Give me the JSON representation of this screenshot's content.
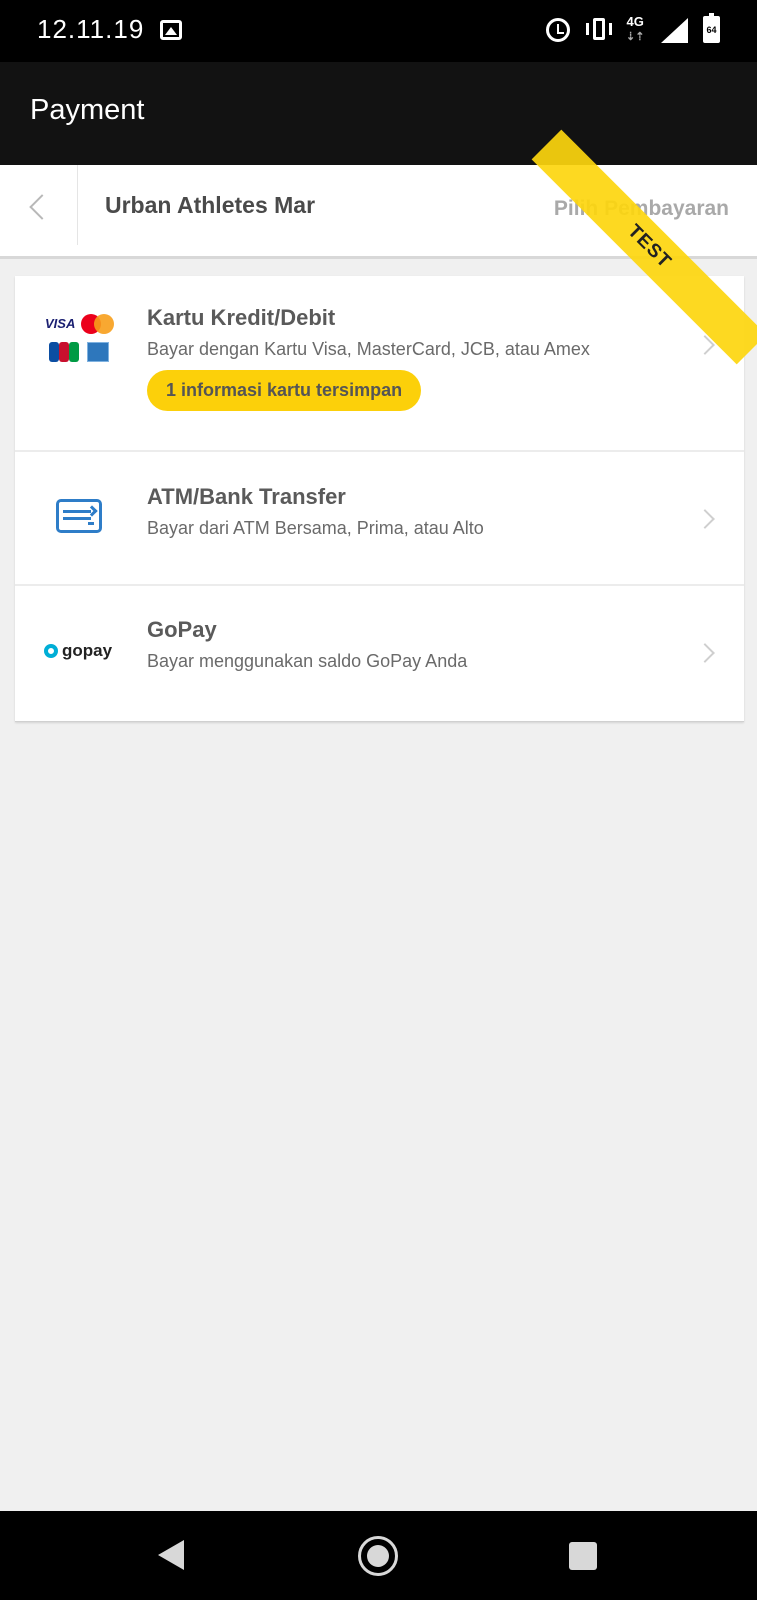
{
  "status_bar": {
    "time": "12.11.19",
    "network": "4G",
    "battery": "64"
  },
  "app_bar": {
    "title": "Payment"
  },
  "merchant": {
    "name": "Urban Athletes Mar",
    "subtitle": "Pilih Pembayaran"
  },
  "ribbon": {
    "label": "TEST"
  },
  "payment_methods": [
    {
      "title": "Kartu Kredit/Debit",
      "subtitle": "Bayar dengan Kartu Visa, MasterCard, JCB, atau Amex",
      "badge": "1 informasi kartu tersimpan",
      "icon": "card-brands-icon",
      "logo_text": "VISA"
    },
    {
      "title": "ATM/Bank Transfer",
      "subtitle": "Bayar dari ATM Bersama, Prima, atau Alto",
      "icon": "bank-transfer-icon"
    },
    {
      "title": "GoPay",
      "subtitle": "Bayar menggunakan saldo GoPay Anda",
      "icon": "gopay-logo-icon",
      "logo_text": "gopay"
    }
  ],
  "colors": {
    "accent_yellow": "#fcd00a",
    "atm_blue": "#2e7dc8",
    "gopay_blue": "#00aed6"
  }
}
